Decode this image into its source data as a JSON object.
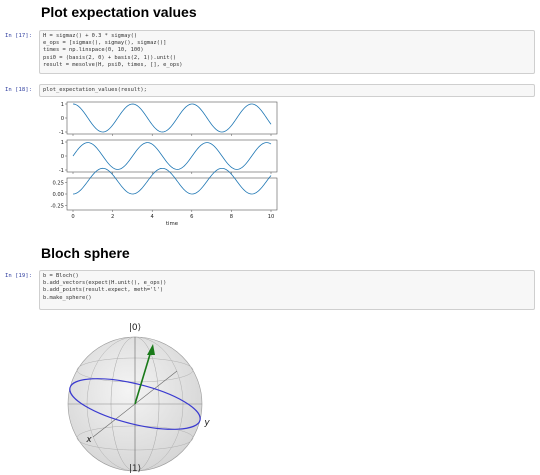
{
  "sections": {
    "plot_heading": "Plot expectation values",
    "bloch_heading": "Bloch sphere"
  },
  "cells": [
    {
      "prompt": "In  [17]:",
      "lines": [
        "H = sigmaz() + 0.3 * sigmay()",
        "e_ops = [sigmax(), sigmay(), sigmaz()]",
        "times = np.linspace(0, 10, 100)",
        "psi0 = (basis(2, 0) + basis(2, 1)).unit()",
        "result = mesolve(H, psi0, times, [], e_ops)"
      ]
    },
    {
      "prompt": "In  [18]:",
      "lines": [
        "plot_expectation_values(result);"
      ]
    },
    {
      "prompt": "In  [19]:",
      "lines": [
        "b = Bloch()",
        "b.add_vectors(expect(H.unit(), e_ops))",
        "b.add_points(result.expect, meth='l')",
        "b.make_sphere()"
      ]
    }
  ],
  "chart_data": {
    "type": "line",
    "xlabel": "time",
    "xlim": [
      0,
      10
    ],
    "x_ticks": [
      "0",
      "2",
      "4",
      "6",
      "8",
      "10"
    ],
    "panels": [
      {
        "ylim": [
          -1,
          1
        ],
        "y_ticks": [
          "1",
          "0",
          "-1"
        ],
        "expression": "cos(2.088 t)"
      },
      {
        "ylim": [
          -1,
          1
        ],
        "y_ticks": [
          "1",
          "0",
          "-1"
        ],
        "expression": "0.958 sin(2.088 t)"
      },
      {
        "ylim": [
          -0.3,
          0.3
        ],
        "y_ticks": [
          "0.25",
          "0.00",
          "-0.25"
        ],
        "expression": "0.275 (1 - cos(2.088 t))"
      }
    ],
    "line_color": "#1f77b4"
  },
  "bloch": {
    "top_label": "|0⟩",
    "bottom_label": "|1⟩",
    "x_label": "x",
    "y_label": "y",
    "vector_color": "#1a7a1a",
    "trajectory_color": "#3a3ad0"
  }
}
